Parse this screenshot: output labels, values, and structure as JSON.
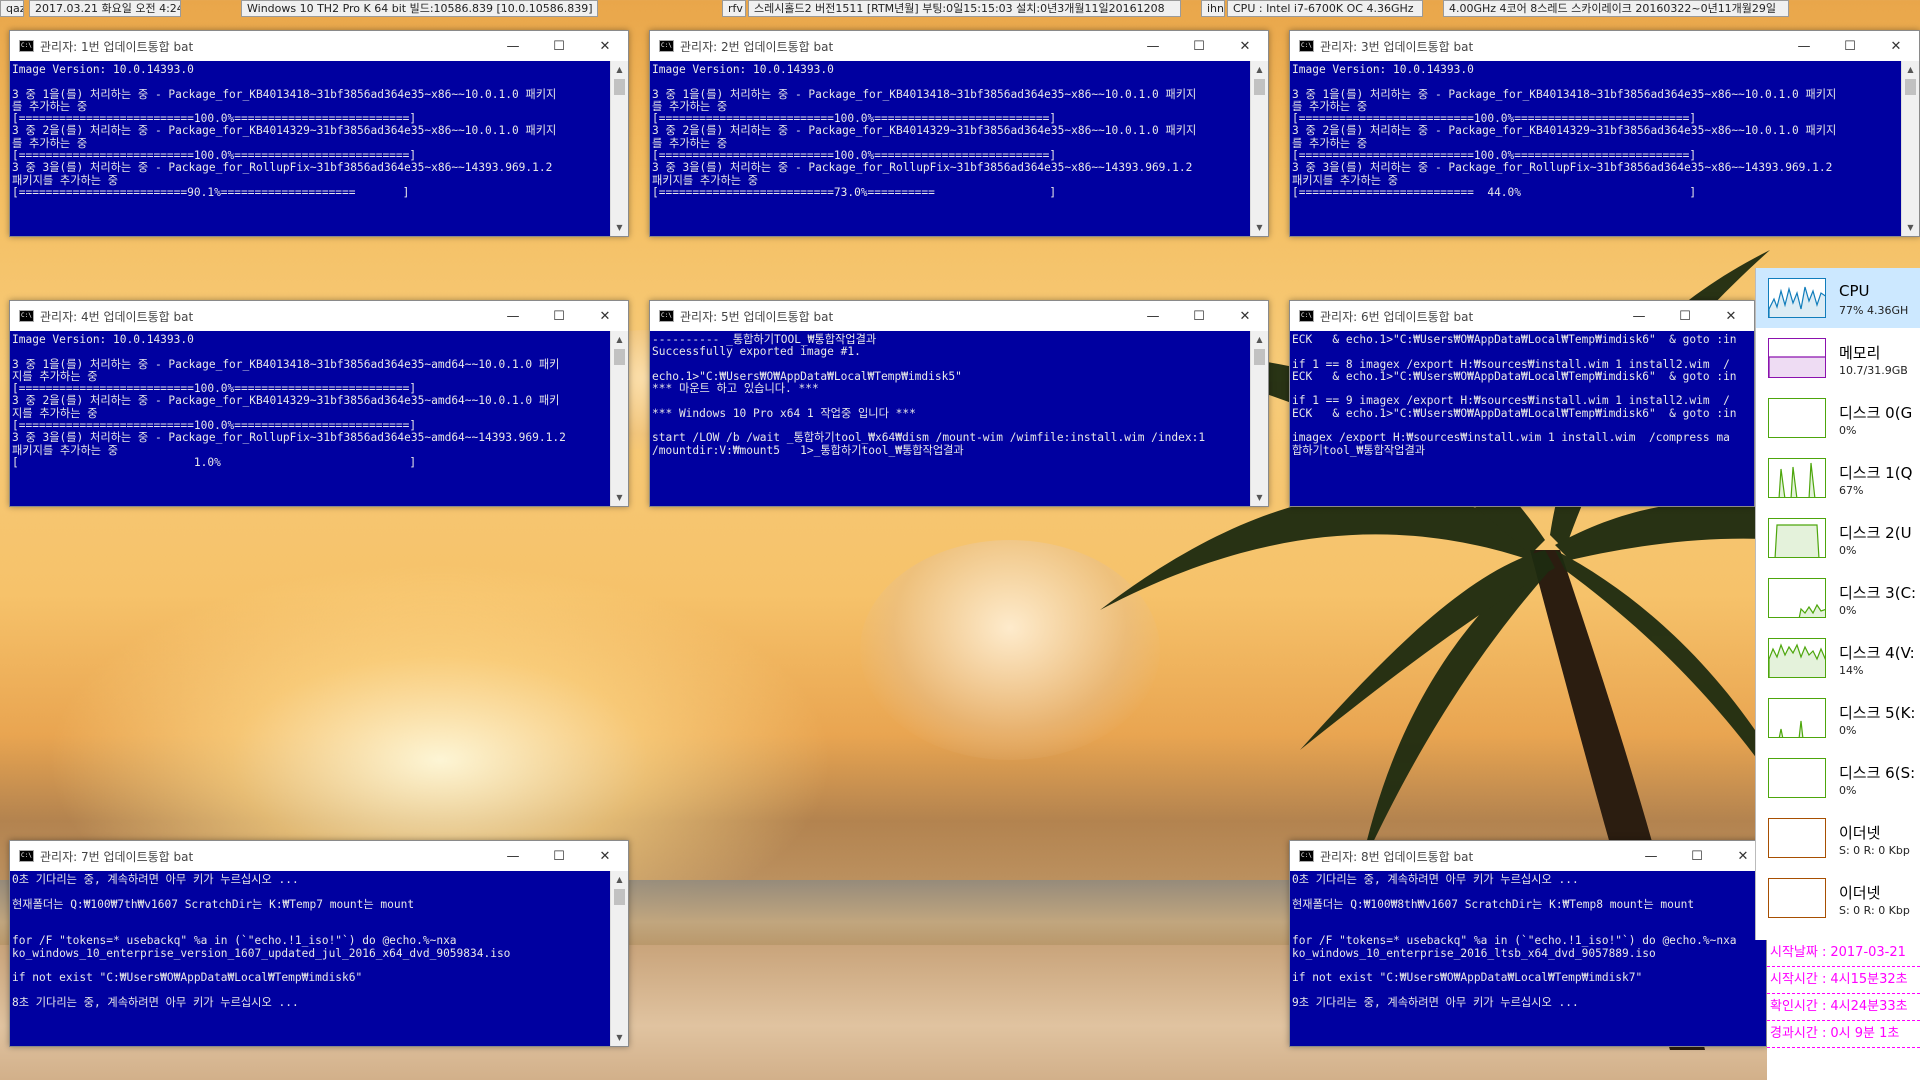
{
  "topbar": [
    "qaz",
    "2017.03.21 화요일 오전 4:24:33",
    "Windows 10 TH2 Pro K 64 bit 빌드:10586.839 [10.0.10586.839]",
    "rfv",
    "스레시홀드2 버전1511 [RTM년월] 부팅:0일15:15:03 설치:0년3개월11일20161208",
    "ihn",
    "CPU : Intel i7-6700K OC 4.36GHz",
    "4.00GHz 4코어 8스레드 스카이레이크 20160322~0년11개월29일"
  ],
  "windows": [
    {
      "title": "관리자: 1번 업데이트통합 bat",
      "lines": [
        "Image Version: 10.0.14393.0",
        "",
        "3 중 1을(를) 처리하는 중 - Package_for_KB4013418~31bf3856ad364e35~x86~~10.0.1.0 패키지",
        "를 추가하는 중",
        "[==========================100.0%==========================]",
        "3 중 2을(를) 처리하는 중 - Package_for_KB4014329~31bf3856ad364e35~x86~~10.0.1.0 패키지",
        "를 추가하는 중",
        "[==========================100.0%==========================]",
        "3 중 3을(를) 처리하는 중 - Package_for_RollupFix~31bf3856ad364e35~x86~~14393.969.1.2",
        "패키지를 추가하는 중",
        "[=========================90.1%====================       ]"
      ]
    },
    {
      "title": "관리자: 2번 업데이트통합 bat",
      "lines": [
        "Image Version: 10.0.14393.0",
        "",
        "3 중 1을(를) 처리하는 중 - Package_for_KB4013418~31bf3856ad364e35~x86~~10.0.1.0 패키지",
        "를 추가하는 중",
        "[==========================100.0%==========================]",
        "3 중 2을(를) 처리하는 중 - Package_for_KB4014329~31bf3856ad364e35~x86~~10.0.1.0 패키지",
        "를 추가하는 중",
        "[==========================100.0%==========================]",
        "3 중 3을(를) 처리하는 중 - Package_for_RollupFix~31bf3856ad364e35~x86~~14393.969.1.2",
        "패키지를 추가하는 중",
        "[==========================73.0%==========                 ]"
      ]
    },
    {
      "title": "관리자: 3번 업데이트통합 bat",
      "lines": [
        "Image Version: 10.0.14393.0",
        "",
        "3 중 1을(를) 처리하는 중 - Package_for_KB4013418~31bf3856ad364e35~x86~~10.0.1.0 패키지",
        "를 추가하는 중",
        "[==========================100.0%==========================]",
        "3 중 2을(를) 처리하는 중 - Package_for_KB4014329~31bf3856ad364e35~x86~~10.0.1.0 패키지",
        "를 추가하는 중",
        "[==========================100.0%==========================]",
        "3 중 3을(를) 처리하는 중 - Package_for_RollupFix~31bf3856ad364e35~x86~~14393.969.1.2",
        "패키지를 추가하는 중",
        "[==========================  44.0%                         ]"
      ]
    },
    {
      "title": "관리자: 4번 업데이트통합 bat",
      "lines": [
        "Image Version: 10.0.14393.0",
        "",
        "3 중 1을(를) 처리하는 중 - Package_for_KB4013418~31bf3856ad364e35~amd64~~10.0.1.0 패키",
        "지를 추가하는 중",
        "[==========================100.0%==========================]",
        "3 중 2을(를) 처리하는 중 - Package_for_KB4014329~31bf3856ad364e35~amd64~~10.0.1.0 패키",
        "지를 추가하는 중",
        "[==========================100.0%==========================]",
        "3 중 3을(를) 처리하는 중 - Package_for_RollupFix~31bf3856ad364e35~amd64~~14393.969.1.2",
        "패키지를 추가하는 중",
        "[                          1.0%                            ]"
      ]
    },
    {
      "title": "관리자: 5번 업데이트통합 bat",
      "lines": [
        "---------- _통합하기TOOL_₩통합작업결과",
        "Successfully exported image #1.",
        "",
        "echo.1>\"C:₩Users₩O₩AppData₩Local₩Temp₩imdisk5\"",
        "*** 마운트 하고 있습니다. ***",
        "",
        "*** Windows 10 Pro x64 1 작업중 입니다 ***",
        "",
        "start /LOW /b /wait _통합하기tool_₩x64₩dism /mount-wim /wimfile:install.wim /index:1",
        "/mountdir:V:₩mount5   1>_통합하기tool_₩통합작업결과"
      ]
    },
    {
      "title": "관리자: 6번 업데이트통합 bat",
      "lines": [
        "ECK   & echo.1>\"C:₩Users₩O₩AppData₩Local₩Temp₩imdisk6\"  & goto :in",
        "",
        "if 1 == 8 imagex /export H:₩sources₩install.wim 1 install2.wim  /",
        "ECK   & echo.1>\"C:₩Users₩O₩AppData₩Local₩Temp₩imdisk6\"  & goto :in",
        "",
        "if 1 == 9 imagex /export H:₩sources₩install.wim 1 install2.wim  /",
        "ECK   & echo.1>\"C:₩Users₩O₩AppData₩Local₩Temp₩imdisk6\"  & goto :in",
        "",
        "imagex /export H:₩sources₩install.wim 1 install.wim  /compress ma",
        "합하기tool_₩통합작업결과"
      ]
    },
    {
      "title": "관리자: 7번 업데이트통합 bat",
      "lines": [
        "0초 기다리는 중, 계속하려면 아무 키가 누르십시오 ...",
        "",
        "현재폴더는 Q:₩100₩7th₩v1607 ScratchDir는 K:₩Temp7 mount는 mount",
        "",
        "",
        "for /F \"tokens=* usebackq\" %a in (`\"echo.!1_iso!\"`) do @echo.%~nxa",
        "ko_windows_10_enterprise_version_1607_updated_jul_2016_x64_dvd_9059834.iso",
        "",
        "if not exist \"C:₩Users₩O₩AppData₩Local₩Temp₩imdisk6\"",
        "",
        "8초 기다리는 중, 계속하려면 아무 키가 누르십시오 ..."
      ]
    },
    {
      "title": "관리자: 8번 업데이트통합 bat",
      "lines": [
        "0초 기다리는 중, 계속하려면 아무 키가 누르십시오 ...",
        "",
        "현재폴더는 Q:₩100₩8th₩v1607 ScratchDir는 K:₩Temp8 mount는 mount",
        "",
        "",
        "for /F \"tokens=* usebackq\" %a in (`\"echo.!1_iso!\"`) do @echo.%~nxa",
        "ko_windows_10_enterprise_2016_ltsb_x64_dvd_9057889.iso",
        "",
        "if not exist \"C:₩Users₩O₩AppData₩Local₩Temp₩imdisk7\"",
        "",
        "9초 기다리는 중, 계속하려면 아무 키가 누르십시오 ..."
      ]
    }
  ],
  "taskmgr": [
    {
      "name": "CPU",
      "value": "77%  4.36GH",
      "color": "#117dbb"
    },
    {
      "name": "메모리",
      "value": "10.7/31.9GB",
      "color": "#8b12ae"
    },
    {
      "name": "디스크 0(G",
      "value": "0%",
      "color": "#4da60c"
    },
    {
      "name": "디스크 1(Q",
      "value": "67%",
      "color": "#4da60c"
    },
    {
      "name": "디스크 2(U",
      "value": "0%",
      "color": "#4da60c"
    },
    {
      "name": "디스크 3(C:",
      "value": "0%",
      "color": "#4da60c"
    },
    {
      "name": "디스크 4(V:",
      "value": "14%",
      "color": "#4da60c"
    },
    {
      "name": "디스크 5(K:",
      "value": "0%",
      "color": "#4da60c"
    },
    {
      "name": "디스크 6(S:",
      "value": "0%",
      "color": "#4da60c"
    },
    {
      "name": "이더넷",
      "value": "S: 0  R: 0 Kbp",
      "color": "#a74f01"
    },
    {
      "name": "이더넷",
      "value": "S: 0  R: 0 Kbp",
      "color": "#a74f01"
    }
  ],
  "info": [
    {
      "label": "시작날짜 :",
      "value": "2017-03-21"
    },
    {
      "label": "시작시간 :",
      "value": "4시15분32초"
    },
    {
      "label": "확인시간 :",
      "value": "4시24분33초"
    },
    {
      "label": "경과시간 :",
      "value": "0시  9분  1초"
    }
  ],
  "controls": {
    "minimize": "—",
    "maximize": "☐",
    "close": "✕"
  }
}
